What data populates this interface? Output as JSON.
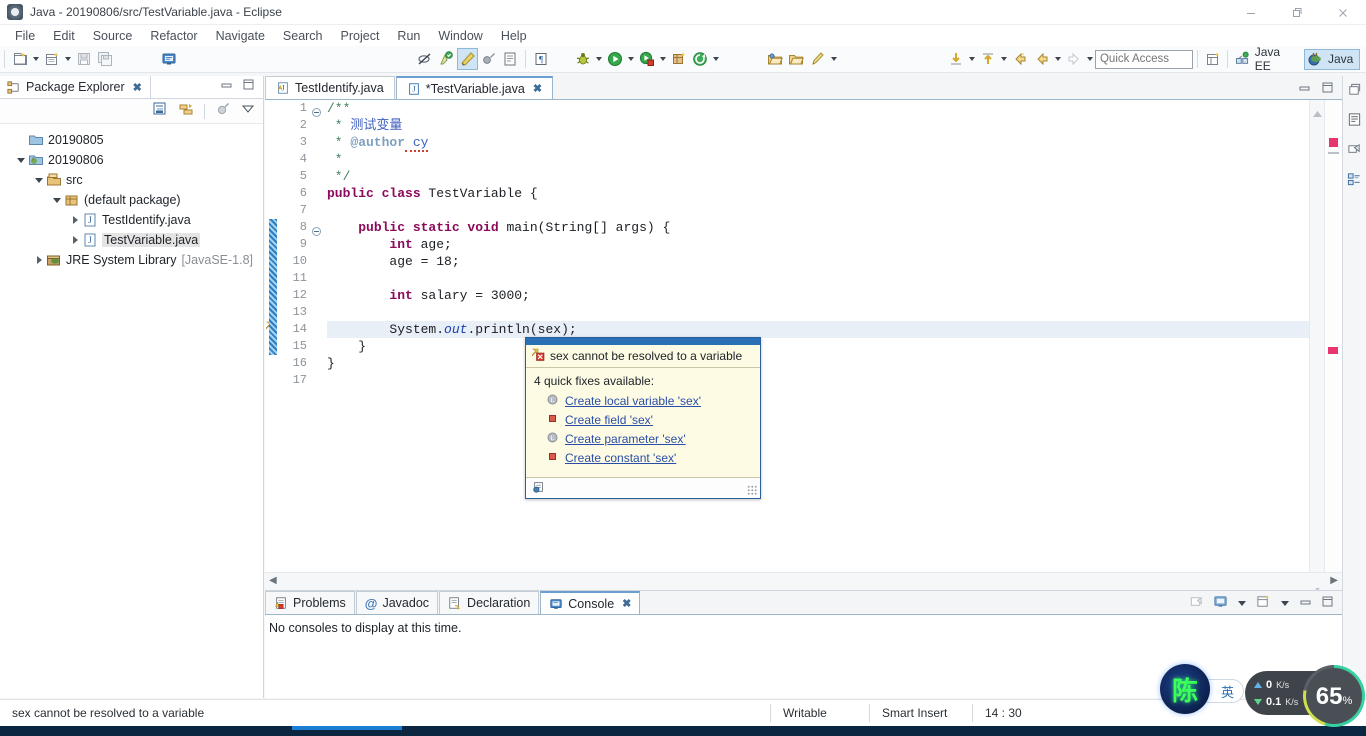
{
  "window": {
    "title": "Java - 20190806/src/TestVariable.java - Eclipse",
    "app_icon": "eclipse-icon",
    "controls": {
      "minimize": "minimize-icon",
      "restore": "restore-icon",
      "close": "close-icon"
    }
  },
  "menubar": {
    "items": [
      "File",
      "Edit",
      "Source",
      "Refactor",
      "Navigate",
      "Search",
      "Project",
      "Run",
      "Window",
      "Help"
    ]
  },
  "toolbar": {
    "quick_access_placeholder": "Quick Access",
    "perspectives": [
      {
        "label": "Java EE",
        "icon": "java-ee-perspective-icon",
        "active": false
      },
      {
        "label": "Java",
        "icon": "java-perspective-icon",
        "active": true
      }
    ],
    "buttons": [
      "new-wizard-icon",
      "new-java-project-icon",
      "save-icon",
      "save-all-icon",
      "print-icon",
      "toggle-mark-occurrences-icon",
      "skip-breakpoints-icon",
      "link-with-editor-icon",
      "external-tools-icon",
      "open-type-icon",
      "search-icon",
      "debug-icon",
      "run-icon",
      "run-coverage-icon",
      "new-java-class-icon",
      "new-annotation-icon",
      "open-task-icon",
      "open-folder-icon",
      "pin-editor-icon",
      "next-annotation-icon",
      "previous-annotation-icon",
      "last-edit-location-icon",
      "back-icon",
      "forward-icon"
    ]
  },
  "package_explorer": {
    "title": "Package Explorer",
    "close_icon": "close-tab-icon",
    "view_buttons": [
      "collapse-all-icon",
      "link-with-editor-icon",
      "view-menu-icon",
      "view-dropdown-icon"
    ],
    "panel_buttons": [
      "minimize-icon",
      "maximize-icon"
    ],
    "tree": [
      {
        "label": "20190805",
        "icon": "folder-icon",
        "indent": 1,
        "twisty": "none",
        "selected": false
      },
      {
        "label": "20190806",
        "icon": "java-project-icon",
        "indent": 1,
        "twisty": "down",
        "selected": false
      },
      {
        "label": "src",
        "icon": "source-folder-icon",
        "indent": 2,
        "twisty": "down",
        "selected": false
      },
      {
        "label": "(default package)",
        "icon": "package-icon",
        "indent": 3,
        "twisty": "down",
        "selected": false
      },
      {
        "label": "TestIdentify.java",
        "icon": "java-file-icon",
        "indent": 4,
        "twisty": "right",
        "selected": false
      },
      {
        "label": "TestVariable.java",
        "icon": "java-file-icon",
        "indent": 4,
        "twisty": "right",
        "selected": true
      },
      {
        "label": "JRE System Library",
        "suffix": "[JavaSE-1.8]",
        "icon": "jre-library-icon",
        "indent": 2,
        "twisty": "right",
        "selected": false
      }
    ]
  },
  "editor": {
    "tabs": [
      {
        "label": "TestIdentify.java",
        "icon": "java-file-warning-icon",
        "active": false,
        "dirty": false,
        "closable": false
      },
      {
        "label": "*TestVariable.java",
        "icon": "java-file-icon",
        "active": true,
        "dirty": true,
        "closable": true
      }
    ],
    "panel_buttons": [
      "minimize-icon",
      "maximize-icon"
    ],
    "lines": [
      {
        "n": 1,
        "fold": "collapse",
        "segments": [
          {
            "t": "/**",
            "c": "cmt"
          }
        ]
      },
      {
        "n": 2,
        "segments": [
          {
            "t": " * ",
            "c": "cmt"
          },
          {
            "t": "测试变量",
            "c": "jdoc"
          }
        ]
      },
      {
        "n": 3,
        "segments": [
          {
            "t": " * ",
            "c": "cmt"
          },
          {
            "t": "@author",
            "c": "jtag"
          },
          {
            "t": " cy",
            "c": "jdoc"
          }
        ]
      },
      {
        "n": 4,
        "segments": [
          {
            "t": " *",
            "c": "cmt"
          }
        ]
      },
      {
        "n": 5,
        "segments": [
          {
            "t": " */",
            "c": "cmt"
          }
        ]
      },
      {
        "n": 6,
        "segments": [
          {
            "t": "public class ",
            "c": "kw"
          },
          {
            "t": "TestVariable {",
            "c": ""
          }
        ]
      },
      {
        "n": 7,
        "segments": [
          {
            "t": "",
            "c": ""
          }
        ]
      },
      {
        "n": 8,
        "fold": "collapse",
        "marked": true,
        "segments": [
          {
            "t": "    ",
            "c": ""
          },
          {
            "t": "public static void ",
            "c": "kw"
          },
          {
            "t": "main(String[] args) {",
            "c": ""
          }
        ]
      },
      {
        "n": 9,
        "marked": true,
        "segments": [
          {
            "t": "        ",
            "c": ""
          },
          {
            "t": "int",
            "c": "kw"
          },
          {
            "t": " age;",
            "c": ""
          }
        ]
      },
      {
        "n": 10,
        "marked": true,
        "segments": [
          {
            "t": "        age = 18;",
            "c": ""
          }
        ]
      },
      {
        "n": 11,
        "marked": true,
        "segments": [
          {
            "t": "",
            "c": ""
          }
        ]
      },
      {
        "n": 12,
        "marked": true,
        "segments": [
          {
            "t": "        ",
            "c": ""
          },
          {
            "t": "int",
            "c": "kw"
          },
          {
            "t": " salary = 3000;",
            "c": ""
          }
        ]
      },
      {
        "n": 13,
        "marked": true,
        "segments": [
          {
            "t": "",
            "c": ""
          }
        ]
      },
      {
        "n": 14,
        "marked": true,
        "error": true,
        "highlight": true,
        "segments": [
          {
            "t": "        System.",
            "c": ""
          },
          {
            "t": "out",
            "c": "fld"
          },
          {
            "t": ".println(",
            "c": ""
          },
          {
            "t": "sex",
            "c": "err"
          },
          {
            "t": ");",
            "c": ""
          }
        ]
      },
      {
        "n": 15,
        "marked": true,
        "segments": [
          {
            "t": "    }",
            "c": ""
          }
        ]
      },
      {
        "n": 16,
        "segments": [
          {
            "t": "}",
            "c": ""
          }
        ]
      },
      {
        "n": 17,
        "segments": [
          {
            "t": "",
            "c": ""
          }
        ]
      }
    ],
    "overview_marker": "error-marker"
  },
  "quick_fix": {
    "problem": "sex cannot be resolved to a variable",
    "problem_icon": "error-marker-icon",
    "subtitle": "4 quick fixes available:",
    "items": [
      {
        "label": "Create local variable 'sex'",
        "icon": "local-variable-icon"
      },
      {
        "label": "Create field 'sex'",
        "icon": "field-icon"
      },
      {
        "label": "Create parameter 'sex'",
        "icon": "parameter-icon"
      },
      {
        "label": "Create constant 'sex'",
        "icon": "constant-icon"
      }
    ],
    "footer_icon": "configure-problem-severity-icon",
    "resize_grip": "resize-grip"
  },
  "bottom_panel": {
    "tabs": [
      {
        "label": "Problems",
        "icon": "problems-icon",
        "active": false,
        "closable": false
      },
      {
        "label": "Javadoc",
        "icon": "javadoc-at-icon",
        "active": false,
        "closable": false
      },
      {
        "label": "Declaration",
        "icon": "declaration-icon",
        "active": false,
        "closable": false
      },
      {
        "label": "Console",
        "icon": "console-icon",
        "active": true,
        "closable": true
      }
    ],
    "buttons": [
      "open-console-icon",
      "display-selected-console-icon",
      "display-console-dropdown-icon",
      "new-console-view-icon",
      "new-console-dropdown-icon",
      "minimize-icon",
      "maximize-icon"
    ],
    "body_text": "No consoles to display at this time."
  },
  "rail": {
    "buttons": [
      "restore-icon",
      "outline-view-icon",
      "task-list-icon",
      "package-explorer-icon"
    ]
  },
  "statusbar": {
    "message": "sex cannot be resolved to a variable",
    "writable": "Writable",
    "insert_mode": "Smart Insert",
    "position": "14 : 30"
  },
  "overlays": {
    "ime": {
      "logo_char": "陈",
      "mode_label": "英"
    },
    "network_monitor": {
      "upload_value": "0",
      "upload_unit": "K/s",
      "download_value": "0.1",
      "download_unit": "K/s",
      "cpu_value": "65",
      "cpu_unit": "%"
    }
  },
  "colors": {
    "accent_blue": "#2a6fb5",
    "tab_active_border": "#6a9fd0",
    "error_red": "#d23b2e",
    "keyword_magenta": "#8b0a5b",
    "comment_green": "#3f7f5f",
    "javadoc_blue": "#3f5fbf",
    "link_blue": "#2a4ea8",
    "popup_bg": "#fdfbe3",
    "selection_bg": "#e8eff7"
  }
}
